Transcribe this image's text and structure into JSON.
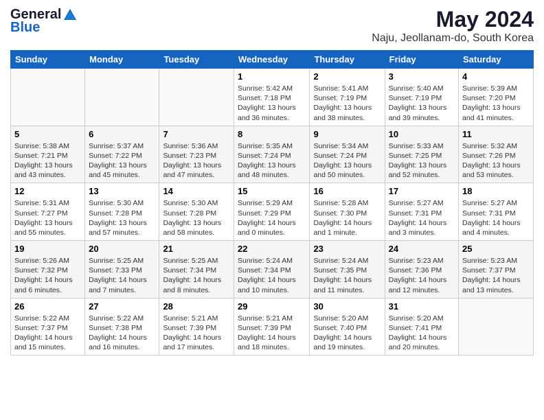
{
  "logo": {
    "general": "General",
    "blue": "Blue"
  },
  "title": "May 2024",
  "location": "Naju, Jeollanam-do, South Korea",
  "days_of_week": [
    "Sunday",
    "Monday",
    "Tuesday",
    "Wednesday",
    "Thursday",
    "Friday",
    "Saturday"
  ],
  "weeks": [
    [
      {
        "day": "",
        "info": ""
      },
      {
        "day": "",
        "info": ""
      },
      {
        "day": "",
        "info": ""
      },
      {
        "day": "1",
        "info": "Sunrise: 5:42 AM\nSunset: 7:18 PM\nDaylight: 13 hours\nand 36 minutes."
      },
      {
        "day": "2",
        "info": "Sunrise: 5:41 AM\nSunset: 7:19 PM\nDaylight: 13 hours\nand 38 minutes."
      },
      {
        "day": "3",
        "info": "Sunrise: 5:40 AM\nSunset: 7:19 PM\nDaylight: 13 hours\nand 39 minutes."
      },
      {
        "day": "4",
        "info": "Sunrise: 5:39 AM\nSunset: 7:20 PM\nDaylight: 13 hours\nand 41 minutes."
      }
    ],
    [
      {
        "day": "5",
        "info": "Sunrise: 5:38 AM\nSunset: 7:21 PM\nDaylight: 13 hours\nand 43 minutes."
      },
      {
        "day": "6",
        "info": "Sunrise: 5:37 AM\nSunset: 7:22 PM\nDaylight: 13 hours\nand 45 minutes."
      },
      {
        "day": "7",
        "info": "Sunrise: 5:36 AM\nSunset: 7:23 PM\nDaylight: 13 hours\nand 47 minutes."
      },
      {
        "day": "8",
        "info": "Sunrise: 5:35 AM\nSunset: 7:24 PM\nDaylight: 13 hours\nand 48 minutes."
      },
      {
        "day": "9",
        "info": "Sunrise: 5:34 AM\nSunset: 7:24 PM\nDaylight: 13 hours\nand 50 minutes."
      },
      {
        "day": "10",
        "info": "Sunrise: 5:33 AM\nSunset: 7:25 PM\nDaylight: 13 hours\nand 52 minutes."
      },
      {
        "day": "11",
        "info": "Sunrise: 5:32 AM\nSunset: 7:26 PM\nDaylight: 13 hours\nand 53 minutes."
      }
    ],
    [
      {
        "day": "12",
        "info": "Sunrise: 5:31 AM\nSunset: 7:27 PM\nDaylight: 13 hours\nand 55 minutes."
      },
      {
        "day": "13",
        "info": "Sunrise: 5:30 AM\nSunset: 7:28 PM\nDaylight: 13 hours\nand 57 minutes."
      },
      {
        "day": "14",
        "info": "Sunrise: 5:30 AM\nSunset: 7:28 PM\nDaylight: 13 hours\nand 58 minutes."
      },
      {
        "day": "15",
        "info": "Sunrise: 5:29 AM\nSunset: 7:29 PM\nDaylight: 14 hours\nand 0 minutes."
      },
      {
        "day": "16",
        "info": "Sunrise: 5:28 AM\nSunset: 7:30 PM\nDaylight: 14 hours\nand 1 minute."
      },
      {
        "day": "17",
        "info": "Sunrise: 5:27 AM\nSunset: 7:31 PM\nDaylight: 14 hours\nand 3 minutes."
      },
      {
        "day": "18",
        "info": "Sunrise: 5:27 AM\nSunset: 7:31 PM\nDaylight: 14 hours\nand 4 minutes."
      }
    ],
    [
      {
        "day": "19",
        "info": "Sunrise: 5:26 AM\nSunset: 7:32 PM\nDaylight: 14 hours\nand 6 minutes."
      },
      {
        "day": "20",
        "info": "Sunrise: 5:25 AM\nSunset: 7:33 PM\nDaylight: 14 hours\nand 7 minutes."
      },
      {
        "day": "21",
        "info": "Sunrise: 5:25 AM\nSunset: 7:34 PM\nDaylight: 14 hours\nand 8 minutes."
      },
      {
        "day": "22",
        "info": "Sunrise: 5:24 AM\nSunset: 7:34 PM\nDaylight: 14 hours\nand 10 minutes."
      },
      {
        "day": "23",
        "info": "Sunrise: 5:24 AM\nSunset: 7:35 PM\nDaylight: 14 hours\nand 11 minutes."
      },
      {
        "day": "24",
        "info": "Sunrise: 5:23 AM\nSunset: 7:36 PM\nDaylight: 14 hours\nand 12 minutes."
      },
      {
        "day": "25",
        "info": "Sunrise: 5:23 AM\nSunset: 7:37 PM\nDaylight: 14 hours\nand 13 minutes."
      }
    ],
    [
      {
        "day": "26",
        "info": "Sunrise: 5:22 AM\nSunset: 7:37 PM\nDaylight: 14 hours\nand 15 minutes."
      },
      {
        "day": "27",
        "info": "Sunrise: 5:22 AM\nSunset: 7:38 PM\nDaylight: 14 hours\nand 16 minutes."
      },
      {
        "day": "28",
        "info": "Sunrise: 5:21 AM\nSunset: 7:39 PM\nDaylight: 14 hours\nand 17 minutes."
      },
      {
        "day": "29",
        "info": "Sunrise: 5:21 AM\nSunset: 7:39 PM\nDaylight: 14 hours\nand 18 minutes."
      },
      {
        "day": "30",
        "info": "Sunrise: 5:20 AM\nSunset: 7:40 PM\nDaylight: 14 hours\nand 19 minutes."
      },
      {
        "day": "31",
        "info": "Sunrise: 5:20 AM\nSunset: 7:41 PM\nDaylight: 14 hours\nand 20 minutes."
      },
      {
        "day": "",
        "info": ""
      }
    ]
  ]
}
